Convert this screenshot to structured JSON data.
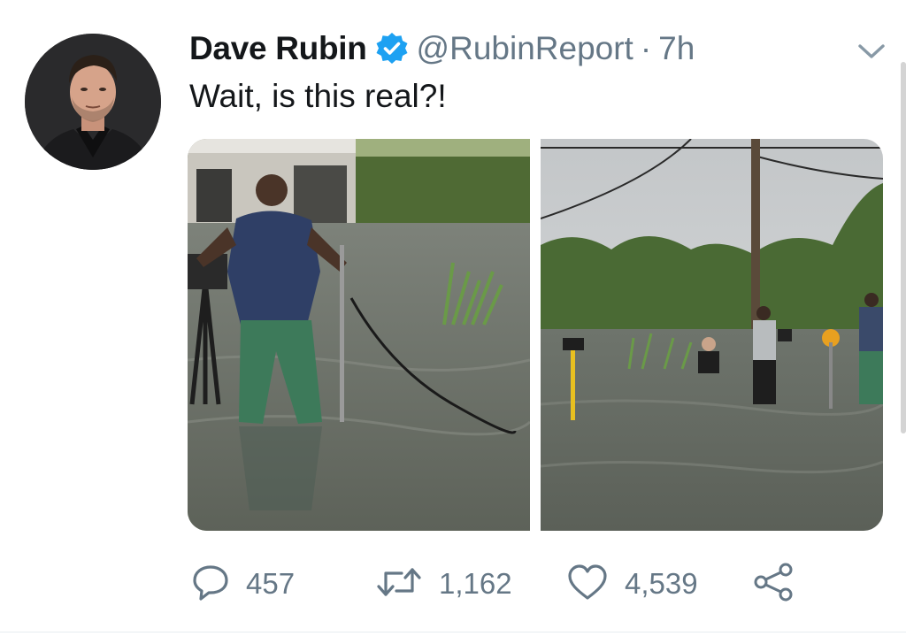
{
  "tweet": {
    "author_name": "Dave Rubin",
    "handle": "@RubinReport",
    "separator": "·",
    "time": "7h",
    "text": "Wait, is this real?!",
    "verified": true,
    "icons": {
      "avatar": "avatar",
      "verified": "verified-badge-icon",
      "menu": "chevron-down-icon",
      "reply": "reply-icon",
      "retweet": "retweet-icon",
      "like": "heart-icon",
      "share": "share-icon"
    },
    "colors": {
      "text": "#14171a",
      "secondary": "#657786",
      "verified_blue": "#1da1f2"
    }
  },
  "actions": {
    "replies": "457",
    "retweets": "1,162",
    "likes": "4,539"
  }
}
